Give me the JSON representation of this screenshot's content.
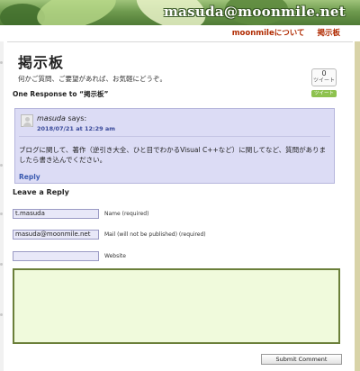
{
  "site": {
    "title": "masuda@moonmile.net"
  },
  "nav": {
    "items": [
      "moonmileについて",
      "掲示板"
    ]
  },
  "page": {
    "title": "掲示板",
    "intro": "何かご質問、ご要望があれば、お気軽にどうぞ。"
  },
  "tweet": {
    "count": "0",
    "count_label": "ツイート",
    "button_label": "ツイート"
  },
  "responses": {
    "heading": "One Response to “掲示板”"
  },
  "comment": {
    "author": "masuda",
    "says": "says:",
    "date": "2018/07/21 at 12:29 am",
    "text": "ブログに関して、著作（逆引き大全、ひと目でわかるVisual C++など）に関してなど、質問がありましたら書き込んでください。",
    "reply_label": "Reply"
  },
  "form": {
    "heading": "Leave a Reply",
    "name_value": "t.masuda",
    "name_label": "Name (required)",
    "mail_value": "masuda@moonmile.net",
    "mail_label": "Mail (will not be published) (required)",
    "website_value": "",
    "website_label": "Website",
    "submit_label": "Submit Comment"
  },
  "colors": {
    "accent": "#b02a00",
    "comment_bg": "#dcdcf5",
    "textarea_bg": "#f0fadc",
    "tweet_green": "#8ec24f"
  }
}
